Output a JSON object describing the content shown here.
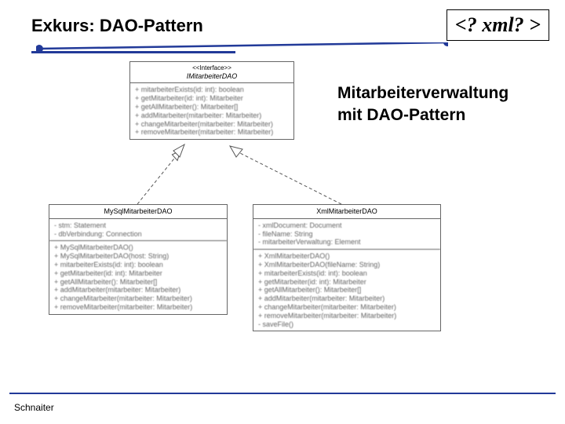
{
  "slide": {
    "title": "Exkurs: DAO-Pattern",
    "badge": "<? xml? >",
    "subtitle_line1": "Mitarbeiterverwaltung",
    "subtitle_line2": "mit DAO-Pattern",
    "footer_author": "Schnaiter"
  },
  "uml": {
    "interface": {
      "stereotype": "<<Interface>>",
      "name": "IMitarbeiterDAO",
      "ops": [
        "+ mitarbeiterExists(id: int): boolean",
        "+ getMitarbeiter(id: int): Mitarbeiter",
        "+ getAllMitarbeiter(): Mitarbeiter[]",
        "+ addMitarbeiter(mitarbeiter: Mitarbeiter)",
        "+ changeMitarbeiter(mitarbeiter: Mitarbeiter)",
        "+ removeMitarbeiter(mitarbeiter: Mitarbeiter)"
      ]
    },
    "mysql": {
      "name": "MySqlMitarbeiterDAO",
      "attrs": [
        "- stm: Statement",
        "- dbVerbindung: Connection"
      ],
      "ops": [
        "+ MySqlMitarbeiterDAO()",
        "+ MySqlMitarbeiterDAO(host: String)",
        "+ mitarbeiterExists(id: int): boolean",
        "+ getMitarbeiter(id: int): Mitarbeiter",
        "+ getAllMitarbeiter(): Mitarbeiter[]",
        "+ addMitarbeiter(mitarbeiter: Mitarbeiter)",
        "+ changeMitarbeiter(mitarbeiter: Mitarbeiter)",
        "+ removeMitarbeiter(mitarbeiter: Mitarbeiter)"
      ]
    },
    "xml": {
      "name": "XmlMitarbeiterDAO",
      "attrs": [
        "- xmlDocument: Document",
        "- fileName: String",
        "- mitarbeiterVerwaltung: Element"
      ],
      "ops": [
        "+ XmlMitarbeiterDAO()",
        "+ XmlMitarbeiterDAO(fileName: String)",
        "+ mitarbeiterExists(id: int): boolean",
        "+ getMitarbeiter(id: int): Mitarbeiter",
        "+ getAllMitarbeiter(): Mitarbeiter[]",
        "+ addMitarbeiter(mitarbeiter: Mitarbeiter)",
        "+ changeMitarbeiter(mitarbeiter: Mitarbeiter)",
        "+ removeMitarbeiter(mitarbeiter: Mitarbeiter)",
        "- saveFile()"
      ]
    }
  },
  "chart_data": {
    "type": "table",
    "title": "UML class diagram: DAO-Pattern for Mitarbeiterverwaltung",
    "interface": "IMitarbeiterDAO",
    "implementations": [
      "MySqlMitarbeiterDAO",
      "XmlMitarbeiterDAO"
    ],
    "relationship": "realization (implements)"
  }
}
